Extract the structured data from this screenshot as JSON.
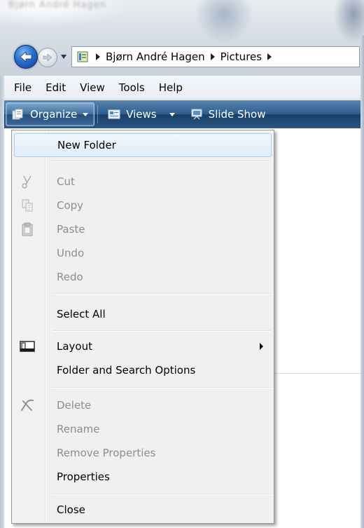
{
  "background_title": "Bjørn André Hagen",
  "address_bar": {
    "crumbs": [
      "Bjørn André Hagen",
      "Pictures"
    ]
  },
  "menu_bar": {
    "items": [
      "File",
      "Edit",
      "View",
      "Tools",
      "Help"
    ]
  },
  "command_bar": {
    "organize": "Organize",
    "views": "Views",
    "slide_show": "Slide Show"
  },
  "organize_menu": {
    "items": [
      {
        "label": "New Folder",
        "enabled": true,
        "highlighted": true
      },
      {
        "label": "Cut",
        "enabled": false,
        "icon": "scissors-icon"
      },
      {
        "label": "Copy",
        "enabled": false,
        "icon": "copy-icon"
      },
      {
        "label": "Paste",
        "enabled": false,
        "icon": "clipboard-icon"
      },
      {
        "label": "Undo",
        "enabled": false
      },
      {
        "label": "Redo",
        "enabled": false
      },
      {
        "label": "Select All",
        "enabled": true
      },
      {
        "label": "Layout",
        "enabled": true,
        "icon": "layout-icon",
        "submenu": true
      },
      {
        "label": "Folder and Search Options",
        "enabled": true
      },
      {
        "label": "Delete",
        "enabled": false,
        "icon": "delete-x-icon"
      },
      {
        "label": "Rename",
        "enabled": false
      },
      {
        "label": "Remove Properties",
        "enabled": false
      },
      {
        "label": "Properties",
        "enabled": true
      },
      {
        "label": "Close",
        "enabled": true
      }
    ]
  },
  "colors": {
    "command_bar": "#2b5c8e",
    "menu_background": "#f0f0f0",
    "highlight_border": "#a8d0f0",
    "disabled_text": "#8d8d8d"
  }
}
